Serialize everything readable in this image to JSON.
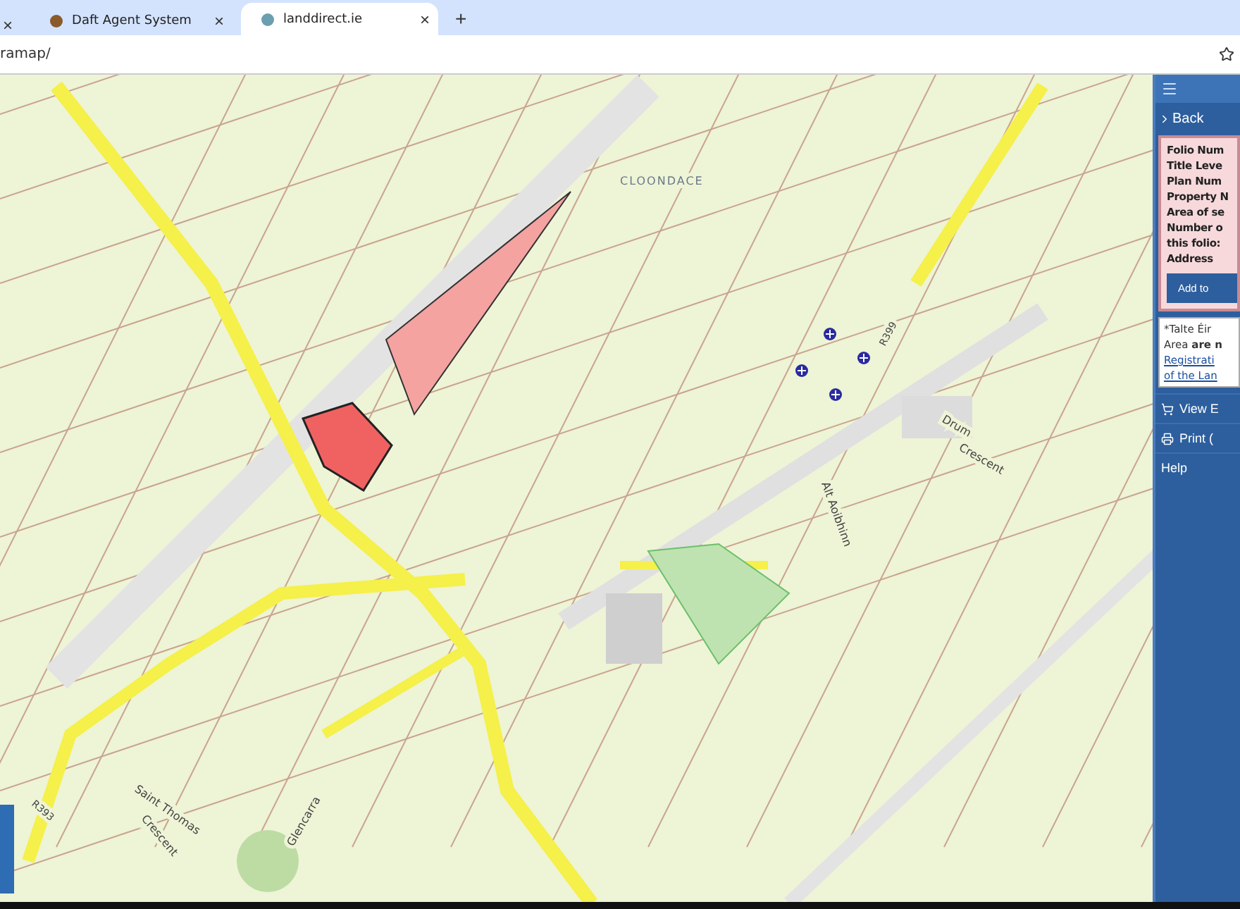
{
  "browser": {
    "tabs": [
      {
        "title": "Daft Agent System",
        "selected": false
      },
      {
        "title": "landdirect.ie",
        "selected": true
      }
    ],
    "close_label": "×",
    "new_tab_label": "+",
    "url": "ramap/"
  },
  "map": {
    "labels": [
      {
        "text": "CLOONDACE",
        "kind": "place"
      },
      {
        "text": "R399",
        "kind": "road"
      },
      {
        "text": "Drum",
        "kind": "street"
      },
      {
        "text": "Crescent",
        "kind": "street"
      },
      {
        "text": "Alt Aoibhinn",
        "kind": "street"
      },
      {
        "text": "Saint Thomas",
        "kind": "street"
      },
      {
        "text": "Crescent",
        "kind": "street"
      },
      {
        "text": "R393",
        "kind": "road"
      },
      {
        "text": "Glencarra",
        "kind": "street"
      }
    ]
  },
  "sidebar": {
    "back": "Back",
    "details": [
      "Folio Num",
      "Title Leve",
      "Plan Num",
      "Property N",
      "Area of se",
      "Number o",
      "this folio:",
      "Address"
    ],
    "add_button": "Add to",
    "notice": [
      "*Talte Éir",
      "Area **are n**"
    ],
    "notice_links": [
      "Registrati",
      "of the Lan"
    ],
    "menu": [
      {
        "label": "View E",
        "kind": "cart"
      },
      {
        "label": "Print (",
        "kind": "print"
      },
      {
        "label": "Help",
        "kind": "plain"
      }
    ]
  }
}
